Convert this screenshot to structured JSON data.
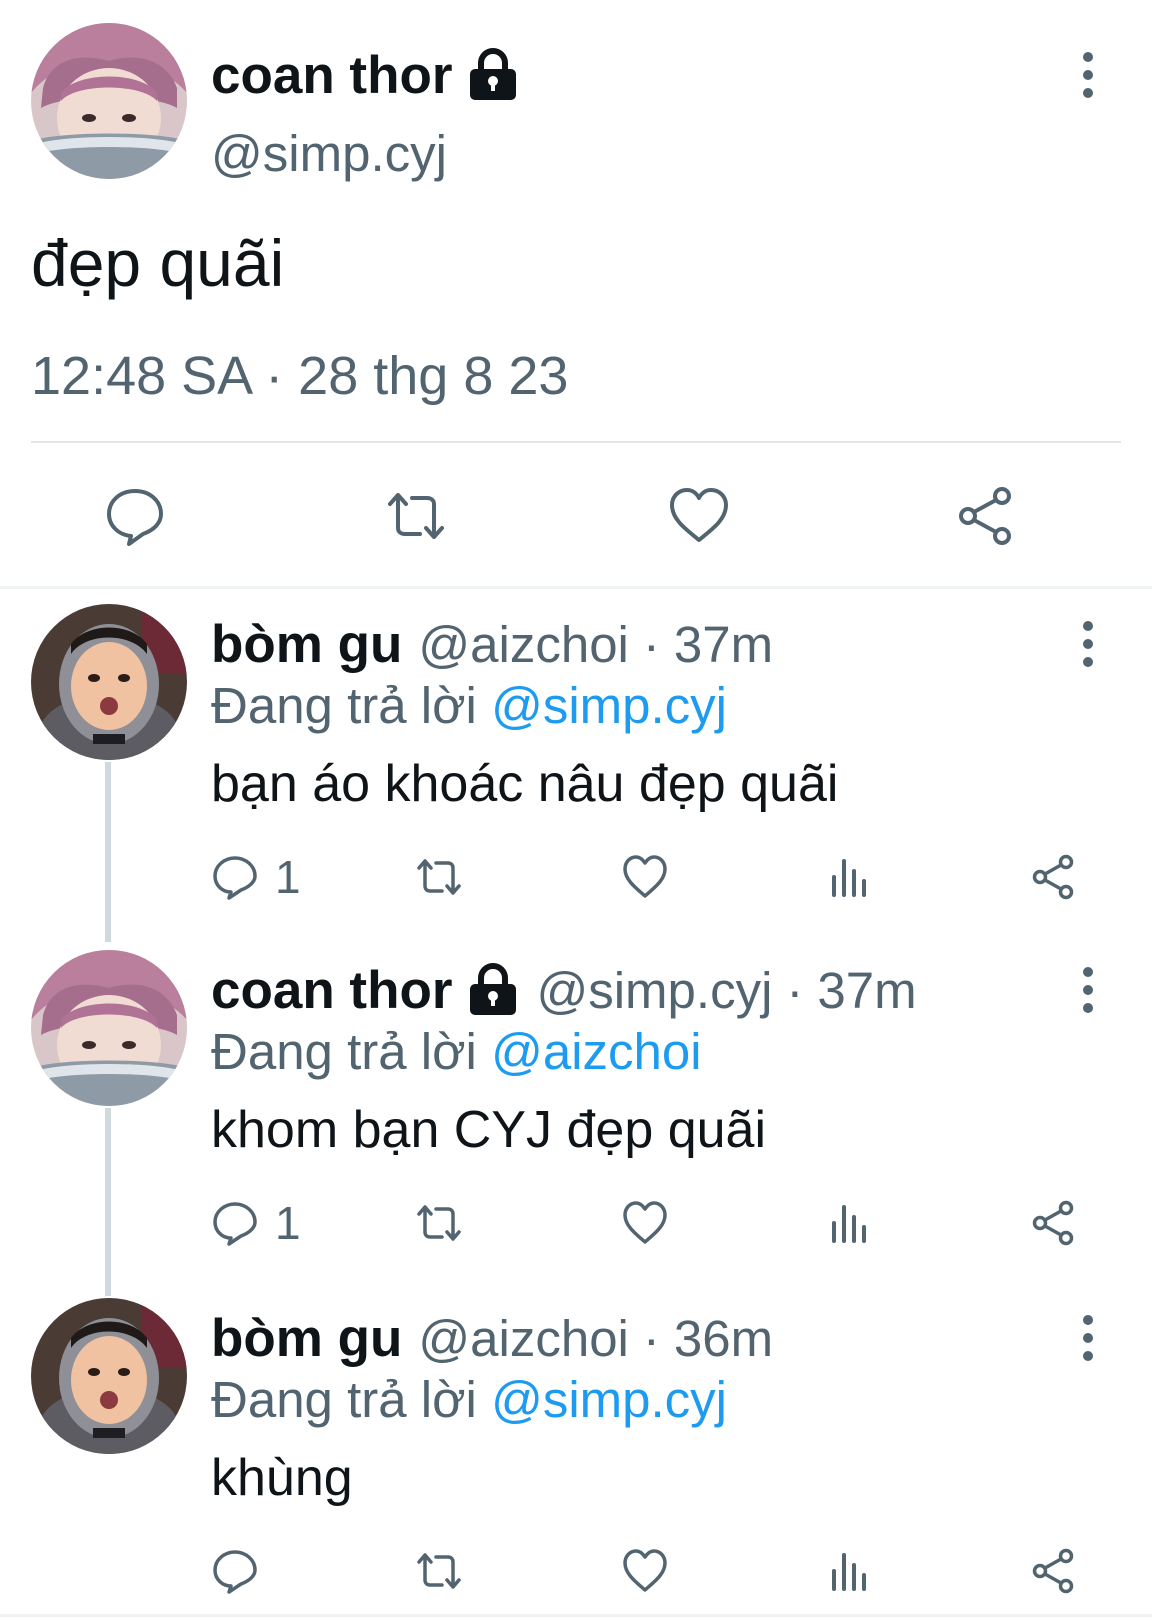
{
  "main_tweet": {
    "author_name": "coan thor",
    "author_handle": "@simp.cyj",
    "protected_icon": "lock-icon",
    "text": "đẹp quãi",
    "timestamp": "12:48 SA · 28 thg 8 23",
    "actions": [
      "reply-icon",
      "retweet-icon",
      "like-icon",
      "share-icon"
    ]
  },
  "replies": [
    {
      "author_name": "bòm gu",
      "author_handle": "@aizchoi",
      "separator": "·",
      "time": "37m",
      "replying_label": "Đang trả lời",
      "replying_to": "@simp.cyj",
      "text": "bạn áo khoác nâu đẹp quãi",
      "reply_count": "1"
    },
    {
      "author_name": "coan thor",
      "author_handle": "@simp.cyj",
      "protected_icon": "lock-icon",
      "separator": "·",
      "time": "37m",
      "replying_label": "Đang trả lời",
      "replying_to": "@aizchoi",
      "text": "khom bạn CYJ đẹp quãi",
      "reply_count": "1"
    },
    {
      "author_name": "bòm gu",
      "author_handle": "@aizchoi",
      "separator": "·",
      "time": "36m",
      "replying_label": "Đang trả lời",
      "replying_to": "@simp.cyj",
      "text": "khùng",
      "reply_count": ""
    }
  ],
  "colors": {
    "text_primary": "#0f1419",
    "text_secondary": "#536471",
    "mention": "#1d9bf0",
    "thread_line": "#cfd9de"
  }
}
